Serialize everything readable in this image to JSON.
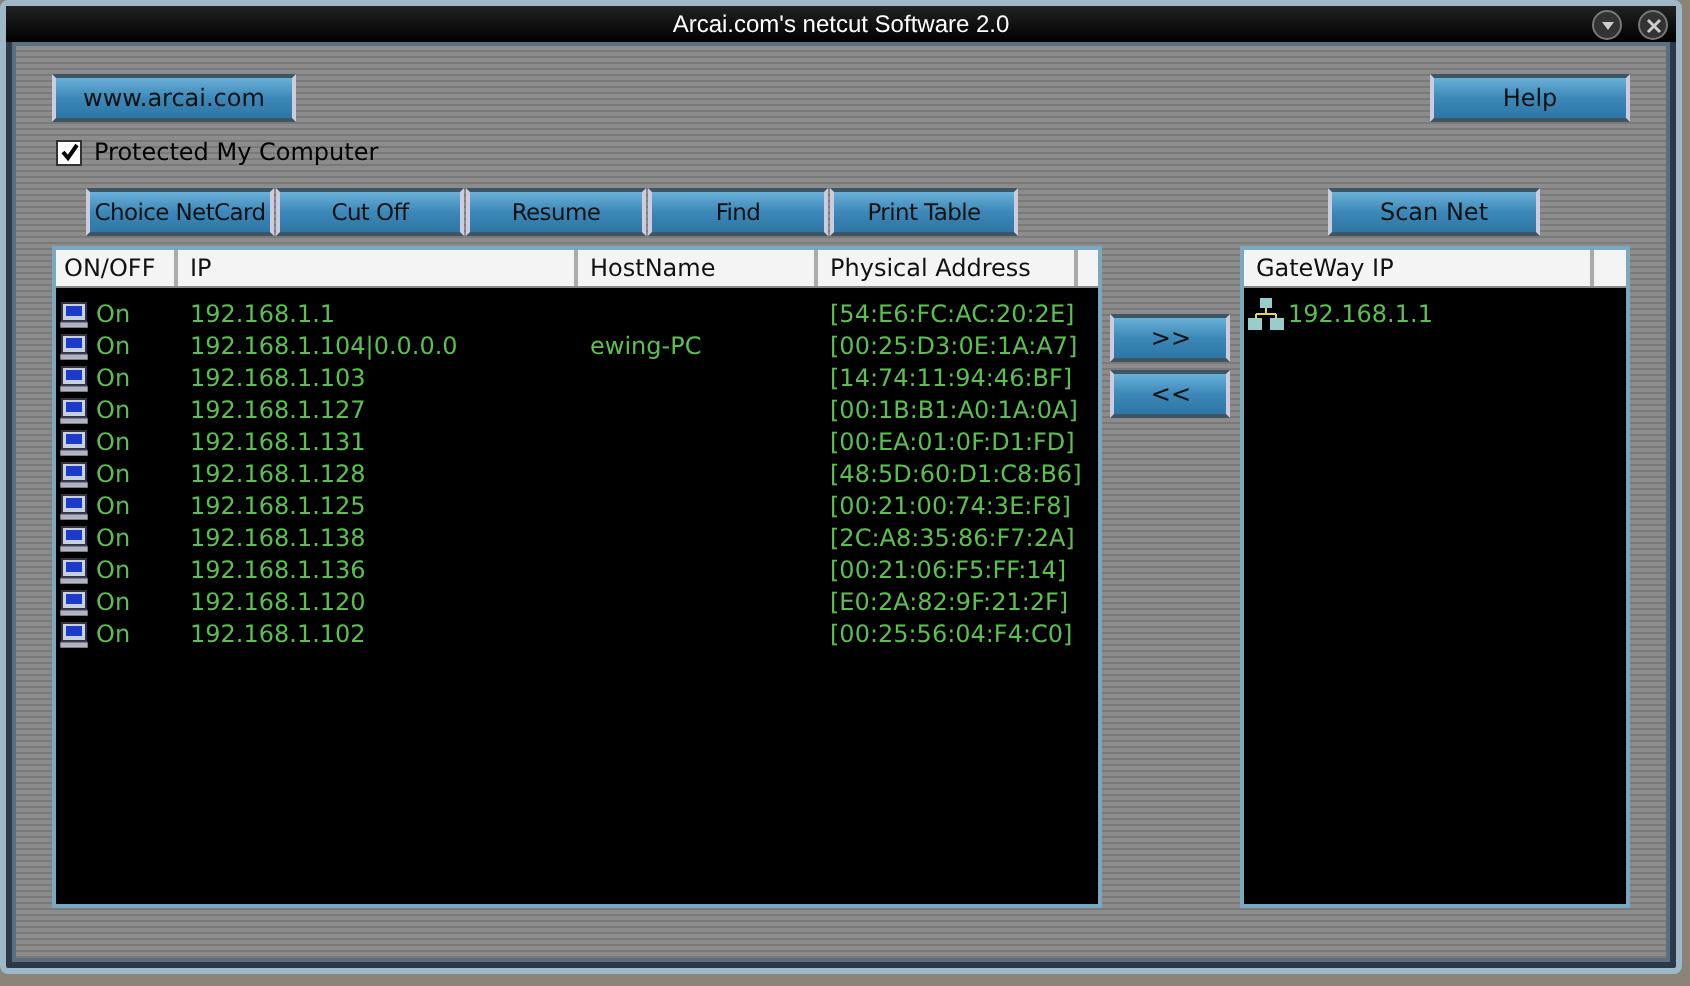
{
  "window": {
    "title": "Arcai.com's netcut Software 2.0"
  },
  "top_buttons": [
    {
      "label": "www.arcai.com",
      "kind": "link"
    },
    {
      "label": "Help",
      "kind": "help"
    }
  ],
  "protect": {
    "label": "Protected My Computer",
    "checked": true
  },
  "toolbar": [
    "Choice NetCard",
    "Cut Off",
    "Resume",
    "Find",
    "Print Table"
  ],
  "scan_button": "Scan Net",
  "table": {
    "columns": [
      "ON/OFF",
      "IP",
      "HostName",
      "Physical Address"
    ],
    "rows": [
      {
        "status": "On",
        "ip": "192.168.1.1",
        "mac": "[54:E6:FC:AC:20:2E]"
      },
      {
        "status": "On",
        "ip": "192.168.1.104|0.0.0.0",
        "hostname": "ewing-PC",
        "mac": "[00:25:D3:0E:1A:A7]"
      },
      {
        "status": "On",
        "ip": "192.168.1.103",
        "mac": "[14:74:11:94:46:BF]"
      },
      {
        "status": "On",
        "ip": "192.168.1.127",
        "mac": "[00:1B:B1:A0:1A:0A]"
      },
      {
        "status": "On",
        "ip": "192.168.1.131",
        "mac": "[00:EA:01:0F:D1:FD]"
      },
      {
        "status": "On",
        "ip": "192.168.1.128",
        "mac": "[48:5D:60:D1:C8:B6]"
      },
      {
        "status": "On",
        "ip": "192.168.1.125",
        "mac": "[00:21:00:74:3E:F8]"
      },
      {
        "status": "On",
        "ip": "192.168.1.138",
        "mac": "[2C:A8:35:86:F7:2A]"
      },
      {
        "status": "On",
        "ip": "192.168.1.136",
        "mac": "[00:21:06:F5:FF:14]"
      },
      {
        "status": "On",
        "ip": "192.168.1.120",
        "mac": "[E0:2A:82:9F:21:2F]"
      },
      {
        "status": "On",
        "ip": "192.168.1.102",
        "mac": "[00:25:56:04:F4:C0]"
      }
    ]
  },
  "move_buttons": [
    ">>",
    "<<"
  ],
  "gateway": {
    "columns": [
      "GateWay IP"
    ],
    "rows": [
      {
        "ip": "192.168.1.1"
      }
    ]
  }
}
